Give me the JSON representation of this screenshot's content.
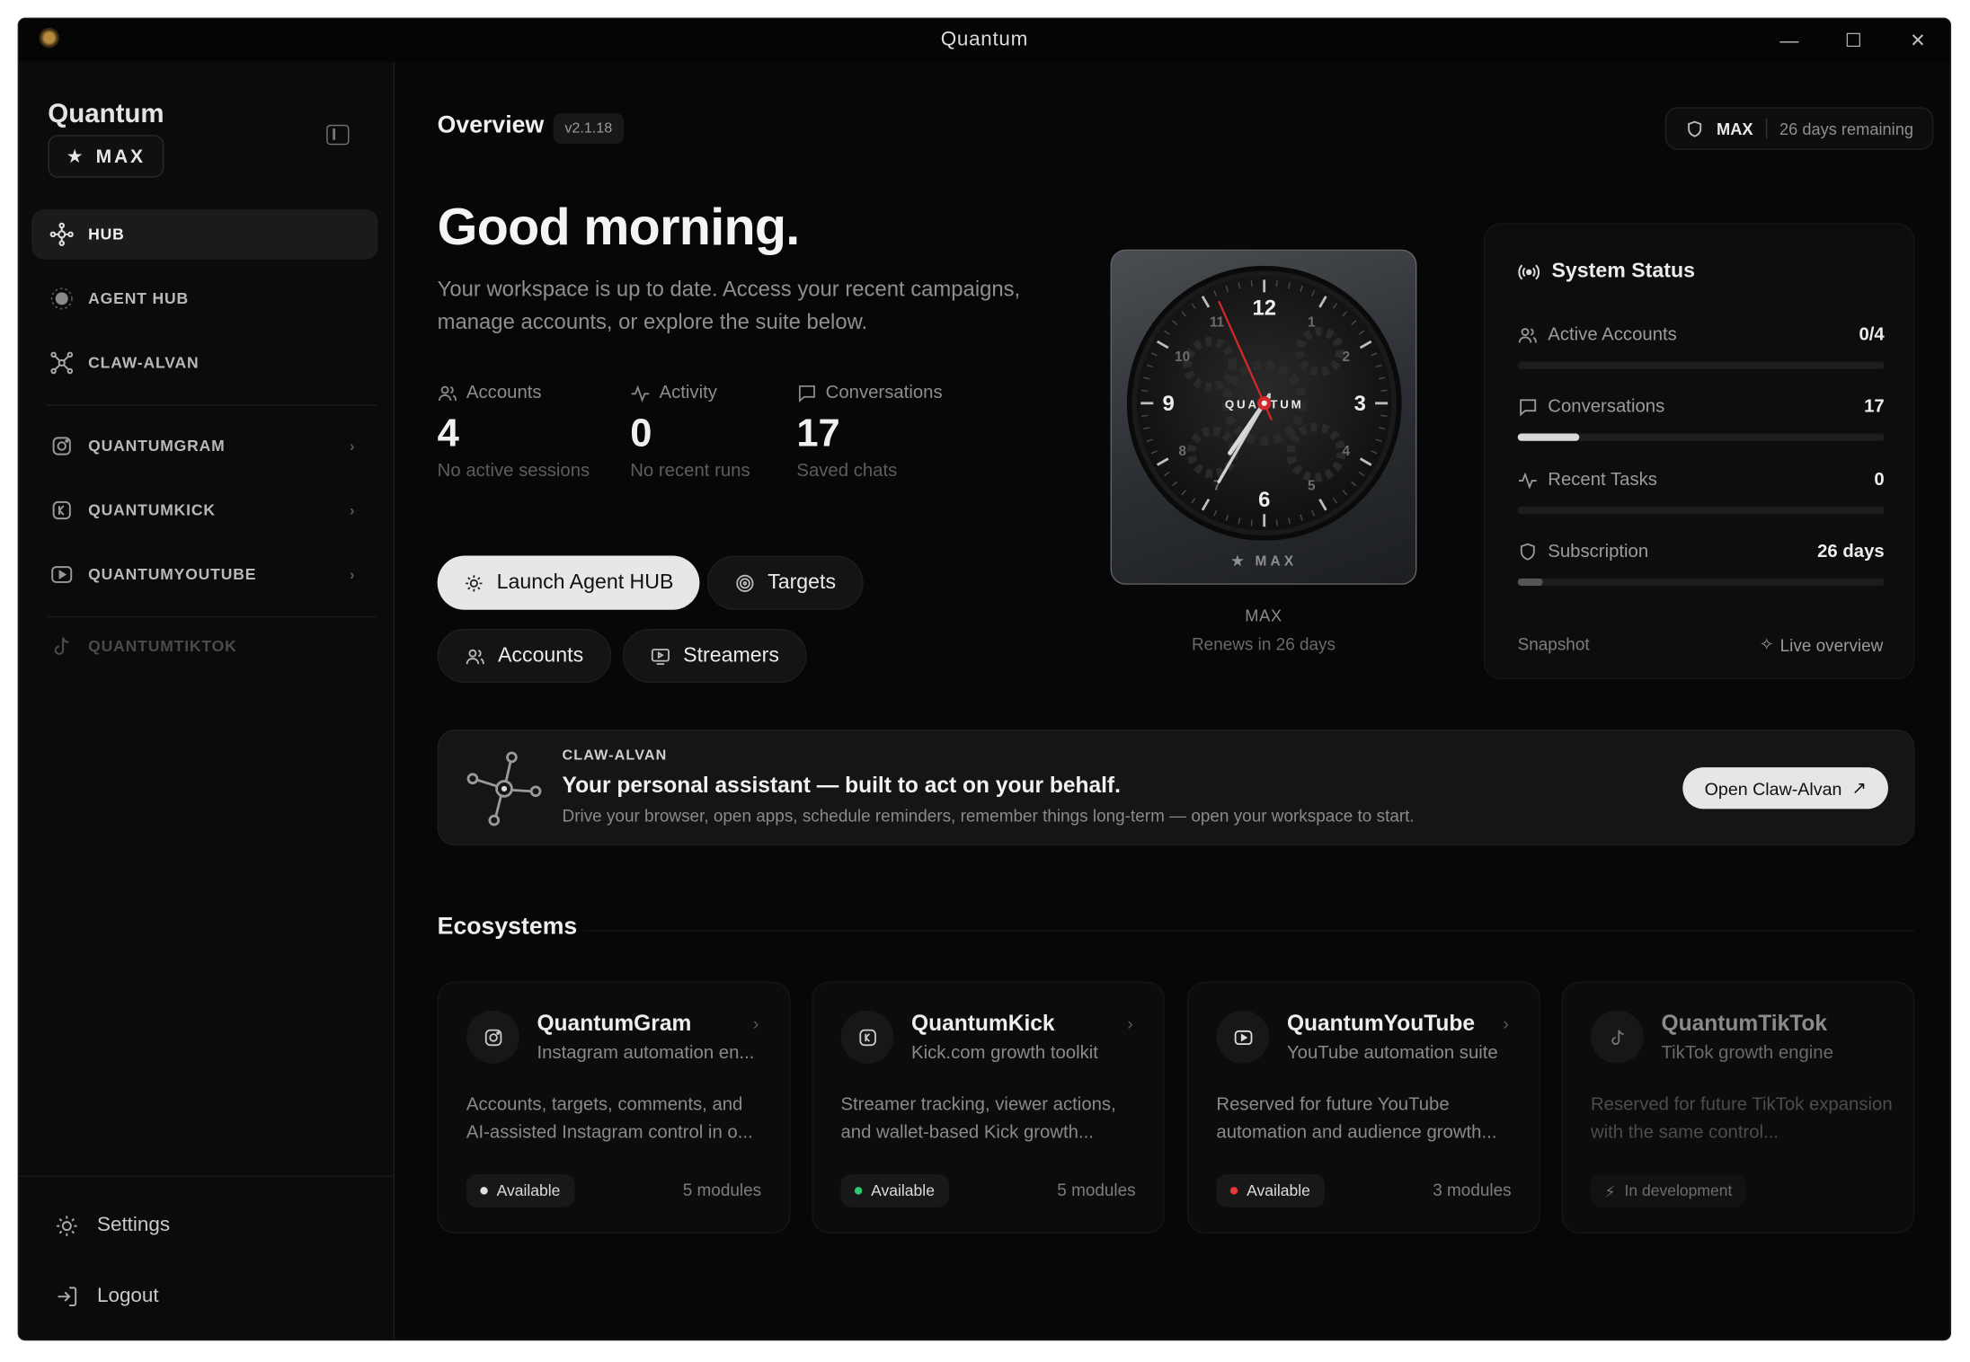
{
  "window": {
    "title": "Quantum"
  },
  "sidebar": {
    "brand": "Quantum",
    "tier": "MAX",
    "items": [
      {
        "label": "HUB",
        "icon": "hub-icon",
        "active": true
      },
      {
        "label": "AGENT HUB",
        "icon": "agent-icon"
      },
      {
        "label": "CLAW-ALVAN",
        "icon": "claw-icon"
      },
      {
        "label": "QUANTUMGRAM",
        "icon": "instagram-icon"
      },
      {
        "label": "QUANTUMKICK",
        "icon": "kick-icon"
      },
      {
        "label": "QUANTUMYOUTUBE",
        "icon": "youtube-icon"
      },
      {
        "label": "QUANTUMTIKTOK",
        "icon": "tiktok-icon",
        "disabled": true
      }
    ],
    "settings": "Settings",
    "logout": "Logout"
  },
  "header": {
    "title": "Overview",
    "version": "v2.1.18",
    "plan": "MAX",
    "remaining": "26 days remaining"
  },
  "hero": {
    "greeting": "Good morning.",
    "description": "Your workspace is up to date. Access your recent campaigns, manage accounts, or explore the suite below."
  },
  "stats": [
    {
      "label": "Accounts",
      "value": "4",
      "sub": "No active sessions"
    },
    {
      "label": "Activity",
      "value": "0",
      "sub": "No recent runs"
    },
    {
      "label": "Conversations",
      "value": "17",
      "sub": "Saved chats"
    }
  ],
  "actions": {
    "launch": "Launch Agent HUB",
    "targets": "Targets",
    "accounts": "Accounts",
    "streamers": "Streamers"
  },
  "clock": {
    "brand": "QUANTUM",
    "badge": "MAX",
    "numerals": [
      "12",
      "1",
      "2",
      "3",
      "4",
      "5",
      "6",
      "7",
      "8",
      "9",
      "10",
      "11"
    ],
    "time": {
      "hour": 7.15,
      "minute": 35,
      "second": 56
    },
    "plan": "MAX",
    "renews": "Renews in 26 days"
  },
  "system_status": {
    "title": "System Status",
    "rows": [
      {
        "label": "Active Accounts",
        "value": "0/4",
        "fill": 0
      },
      {
        "label": "Conversations",
        "value": "17",
        "fill": 0.17
      },
      {
        "label": "Recent Tasks",
        "value": "0",
        "fill": 0
      },
      {
        "label": "Subscription",
        "value": "26 days",
        "fill": 0.07
      }
    ],
    "snapshot": "Snapshot",
    "live": "Live overview"
  },
  "banner": {
    "kicker": "CLAW-ALVAN",
    "headline": "Your personal assistant — built to act on your behalf.",
    "body": "Drive your browser, open apps, schedule reminders, remember things long-term — open your workspace to start.",
    "button": "Open Claw-Alvan"
  },
  "ecosystems": {
    "title": "Ecosystems",
    "cards": [
      {
        "name": "QuantumGram",
        "tagline": "Instagram automation en...",
        "description": "Accounts, targets, comments, and AI-assisted Instagram control in o...",
        "status": "Available",
        "status_color": "#e0e0e0",
        "modules": "5 modules"
      },
      {
        "name": "QuantumKick",
        "tagline": "Kick.com growth toolkit",
        "description": "Streamer tracking, viewer actions, and wallet-based Kick growth...",
        "status": "Available",
        "status_color": "#2ecc71",
        "modules": "5 modules"
      },
      {
        "name": "QuantumYouTube",
        "tagline": "YouTube automation suite",
        "description": "Reserved for future YouTube automation and audience growth...",
        "status": "Available",
        "status_color": "#e5383b",
        "modules": "3 modules"
      },
      {
        "name": "QuantumTikTok",
        "tagline": "TikTok growth engine",
        "description": "Reserved for future TikTok expansion with the same control...",
        "status": "In development",
        "status_color": "#777777",
        "modules": ""
      }
    ]
  }
}
